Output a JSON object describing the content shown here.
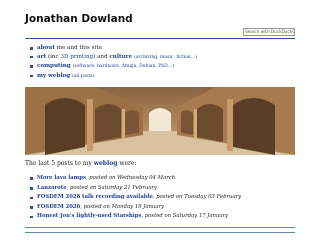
{
  "site": {
    "title": "Jonathan Dowland",
    "search_placeholder": "Search with DuckDuckGo"
  },
  "nav": [
    {
      "link": "about",
      "rest": "me and this site"
    },
    {
      "link": "art",
      "rest_a": "(inc ",
      "link_b": "3D printing",
      "rest_b": ") and ",
      "link_c": "culture",
      "extra": "(archiving, music, fiction…)"
    },
    {
      "link": "computing",
      "extra": "(software, hardware, Amiga, Debian, PhD…)"
    },
    {
      "link": "my weblog",
      "extra": "(all posts)"
    }
  ],
  "photo": {
    "alt": "arched stone colonnade"
  },
  "intro": {
    "prefix": "The last 5 posts to my ",
    "link": "weblog",
    "suffix": " were:"
  },
  "posts": [
    {
      "title": "More lava lamps",
      "meta": ", posted on Wednesday 04 March"
    },
    {
      "title": "Lanzarote",
      "meta": ", posted on Saturday 21 February"
    },
    {
      "title": "FOSDEM 2026 talk recording available",
      "meta": ", posted on Tuesday 03 February"
    },
    {
      "title": "FOSDEM 2026",
      "meta": ", posted on Monday 19 January"
    },
    {
      "title": "Honest Jon's lightly-used Starships",
      "meta": ", posted on Saturday 17 January"
    }
  ],
  "colors": {
    "link": "#1f3f8f",
    "rule": "#27509a",
    "bullet": "#2c4f9a"
  }
}
